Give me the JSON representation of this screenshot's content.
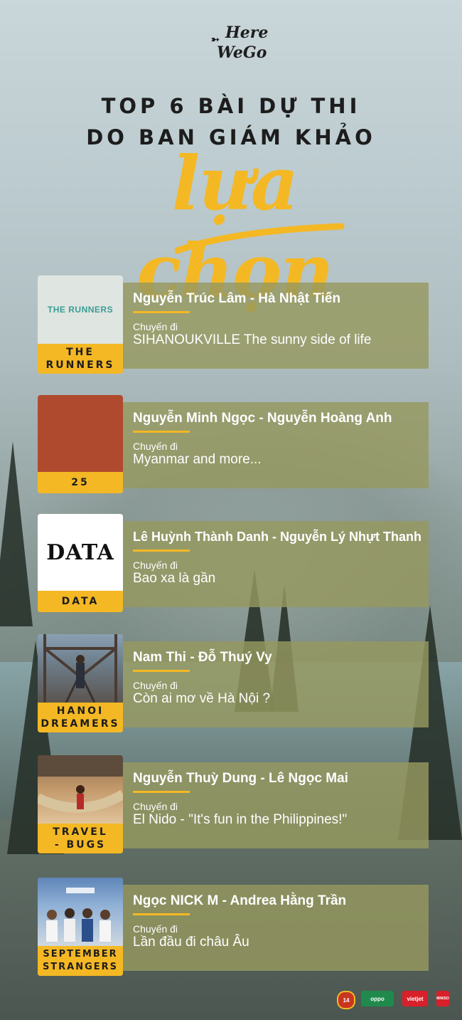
{
  "logo": {
    "line1": "Here",
    "line2": "WeGo"
  },
  "heading": {
    "line1": "TOP 6 BÀI DỰ THI",
    "line2": "DO BAN GIÁM KHẢO",
    "script": "lựa chọn"
  },
  "entries": [
    {
      "thumb_label": "THE RUNNERS",
      "thumb_text": "THE RUNNERS",
      "names": "Nguyễn Trúc Lâm - Hà Nhật Tiến",
      "subtitle": "Chuyến đi",
      "trip": "SIHANOUKVILLE The sunny side of life"
    },
    {
      "thumb_label": "25",
      "thumb_text": "",
      "names": "Nguyễn Minh Ngọc - Nguyễn Hoàng Anh",
      "subtitle": "Chuyến đi",
      "trip": "Myanmar and more..."
    },
    {
      "thumb_label": "DATA",
      "thumb_text": "DATA",
      "names": "Lê Huỳnh Thành Danh - Nguyễn Lý Nhựt Thanh",
      "subtitle": "Chuyến đi",
      "trip": "Bao xa là gần"
    },
    {
      "thumb_label": "HANOI DREAMERS",
      "thumb_text": "",
      "names": "Nam Thi - Đỗ Thuý Vy",
      "subtitle": "Chuyến đi",
      "trip": "Còn ai mơ về Hà Nội ?"
    },
    {
      "thumb_label": "TRAVEL - BUGS",
      "thumb_text": "",
      "names": "Nguyễn Thuỳ Dung - Lê Ngọc Mai",
      "subtitle": "Chuyến đi",
      "trip": "El Nido - \"It's fun in the Philippines!\""
    },
    {
      "thumb_label": "SEPTEMBER STRANGERS",
      "thumb_text": "",
      "names": "Ngọc NICK M - Andrea Hằng Trần",
      "subtitle": "Chuyến đi",
      "trip": "Lần đầu đi châu Âu"
    }
  ],
  "sponsors": [
    "14",
    "oppo",
    "vietjet",
    "MINISO"
  ],
  "colors": {
    "accent": "#f4b824",
    "panel": "#96985f",
    "text": "#ffffff"
  }
}
